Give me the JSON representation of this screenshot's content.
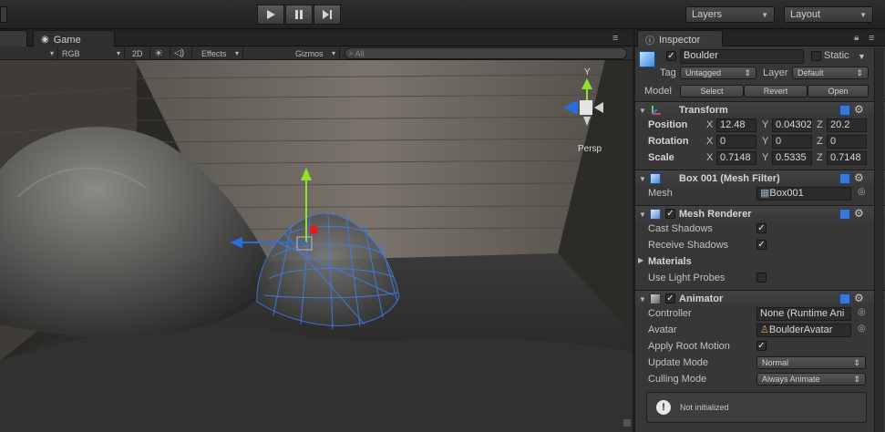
{
  "toolbar": {
    "play_icon": "play-icon",
    "pause_icon": "pause-icon",
    "step_icon": "step-icon",
    "layers_label": "Layers",
    "layout_label": "Layout"
  },
  "game": {
    "tab_label": "Game",
    "display_mode": "RGB",
    "mode_2d": "2D",
    "effects_label": "Effects",
    "gizmos_label": "Gizmos",
    "search_placeholder": "All",
    "persp_label": "Persp",
    "axis_y": "Y"
  },
  "inspector": {
    "tab_label": "Inspector",
    "object_name": "Boulder",
    "static_label": "Static",
    "tag_label": "Tag",
    "tag_value": "Untagged",
    "layer_label": "Layer",
    "layer_value": "Default",
    "model_label": "Model",
    "select_label": "Select",
    "revert_label": "Revert",
    "open_label": "Open",
    "transform": {
      "title": "Transform",
      "position_label": "Position",
      "rotation_label": "Rotation",
      "scale_label": "Scale",
      "x": "X",
      "y": "Y",
      "z": "Z",
      "position": [
        "12.48",
        "0.04302",
        "20.2"
      ],
      "rotation": [
        "0",
        "0",
        "0"
      ],
      "scale": [
        "0.7148",
        "0.5335",
        "0.7148"
      ]
    },
    "mesh_filter": {
      "title": "Box 001 (Mesh Filter)",
      "mesh_label": "Mesh",
      "mesh_value": "Box001"
    },
    "mesh_renderer": {
      "title": "Mesh Renderer",
      "cast_shadows": "Cast Shadows",
      "receive_shadows": "Receive Shadows",
      "materials": "Materials",
      "use_light_probes": "Use Light Probes"
    },
    "animator": {
      "title": "Animator",
      "controller_label": "Controller",
      "controller_value": "None (Runtime Ani",
      "avatar_label": "Avatar",
      "avatar_value": "BoulderAvatar",
      "apply_root_motion": "Apply Root Motion",
      "update_mode_label": "Update Mode",
      "update_mode_value": "Normal",
      "culling_mode_label": "Culling Mode",
      "culling_mode_value": "Always Animate",
      "warning_text": "Not initialized"
    }
  },
  "colors": {
    "editor_bg": "#373737",
    "accent_blue": "#4a7fd6",
    "gizmo_green": "#8ee22c",
    "gizmo_red": "#e02020",
    "gizmo_blue": "#2a6be0"
  }
}
